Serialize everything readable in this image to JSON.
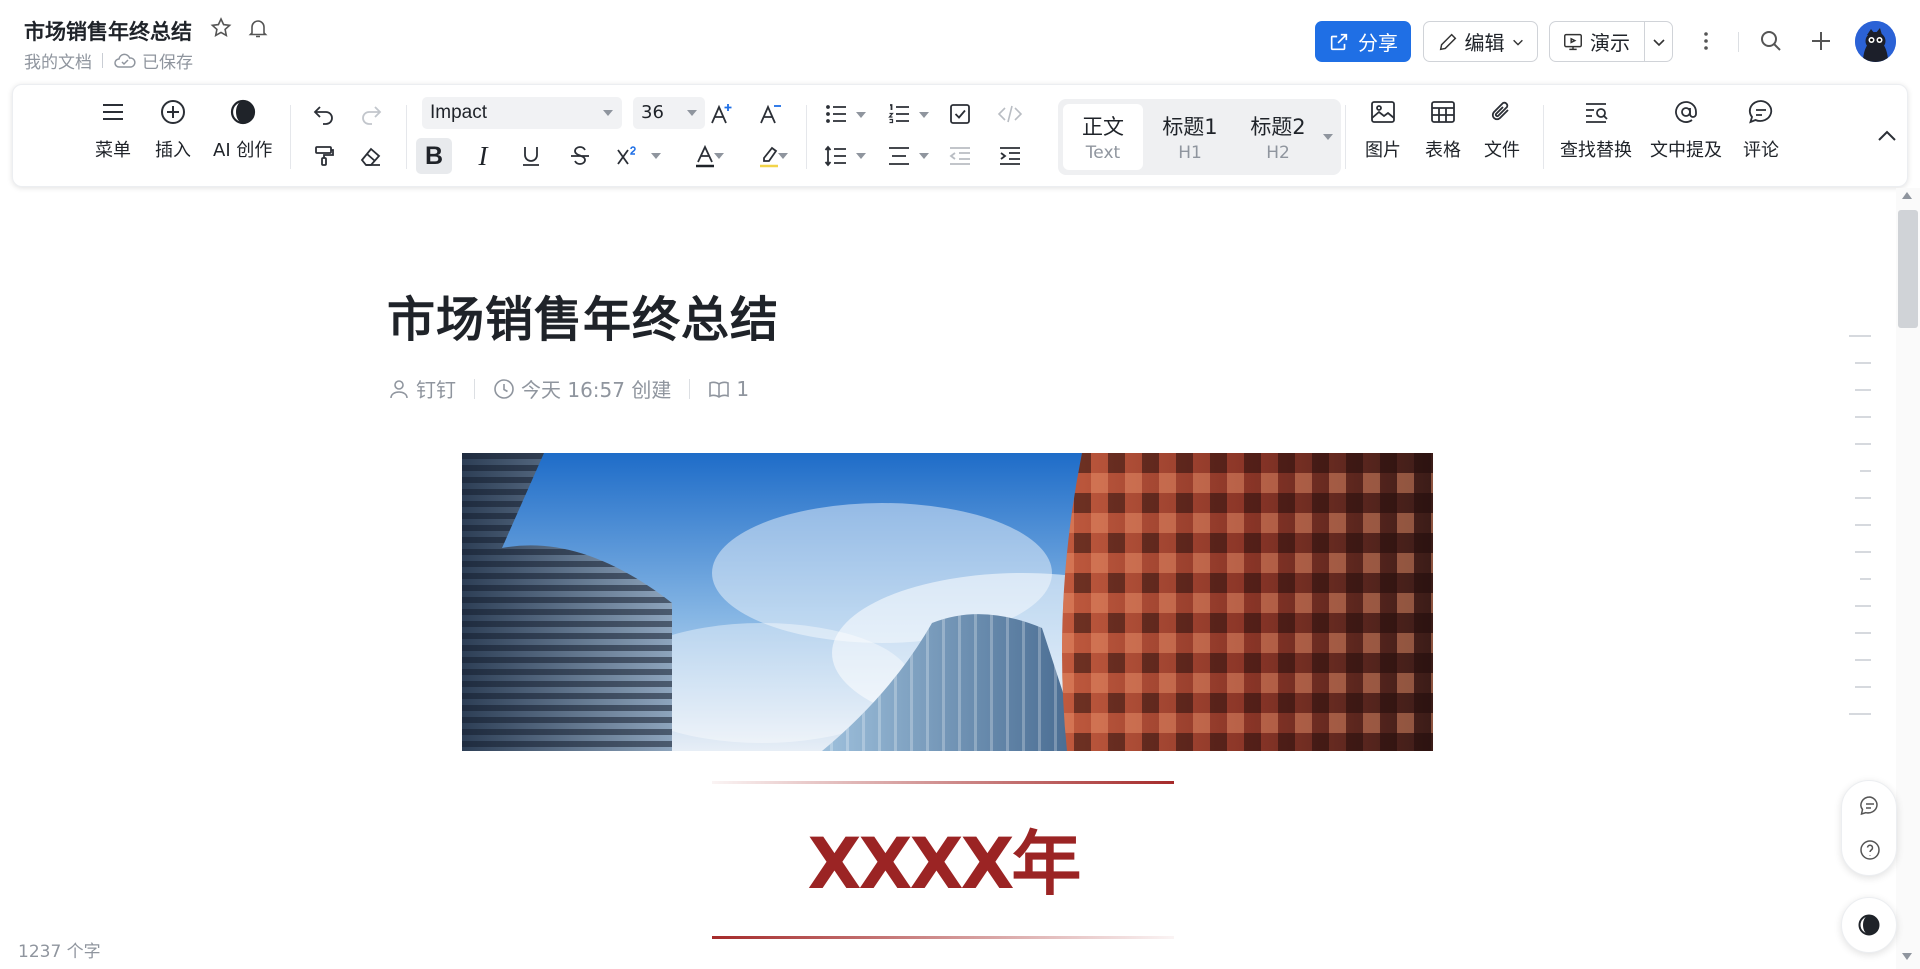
{
  "header": {
    "doc_title": "市场销售年终总结",
    "breadcrumb": "我的文档",
    "save_status": "已保存",
    "share_label": "分享",
    "edit_label": "编辑",
    "present_label": "演示"
  },
  "toolbar": {
    "menu_label": "菜单",
    "insert_label": "插入",
    "ai_label": "AI 创作",
    "font_family": "Impact",
    "font_size": "36",
    "style_text": "正文",
    "style_text_sub": "Text",
    "style_h1": "标题1",
    "style_h1_sub": "H1",
    "style_h2": "标题2",
    "style_h2_sub": "H2",
    "image_label": "图片",
    "table_label": "表格",
    "file_label": "文件",
    "find_replace_label": "查找替换",
    "mention_label": "文中提及",
    "comment_label": "评论"
  },
  "document": {
    "title": "市场销售年终总结",
    "author": "钉钉",
    "created": "今天 16:57 创建",
    "read_count": "1",
    "year_heading": "XXXX年"
  },
  "status": {
    "word_count": "1237 个字"
  },
  "colors": {
    "accent": "#1f6fe5",
    "heading_red": "#9b2424"
  }
}
